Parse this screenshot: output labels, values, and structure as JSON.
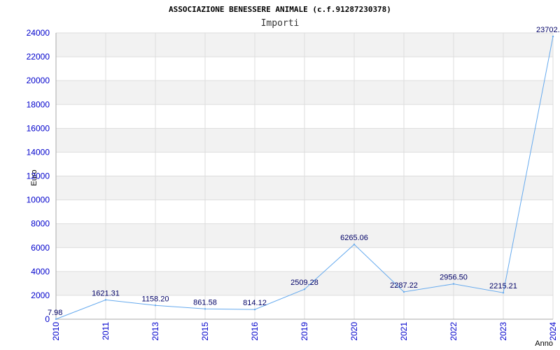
{
  "chart_data": {
    "type": "line",
    "title": "ASSOCIAZIONE BENESSERE ANIMALE (c.f.91287230378)",
    "subtitle": "Importi",
    "xlabel": "Anno",
    "ylabel": "Euro",
    "ylim": [
      0,
      24000
    ],
    "yticks": [
      "0",
      "2000",
      "4000",
      "6000",
      "8000",
      "10000",
      "12000",
      "14000",
      "16000",
      "18000",
      "20000",
      "22000",
      "24000"
    ],
    "grid": true,
    "categories": [
      "2010",
      "2011",
      "2013",
      "2015",
      "2016",
      "2019",
      "2020",
      "2021",
      "2022",
      "2023",
      "2024"
    ],
    "values": [
      7.98,
      1621.31,
      1158.2,
      861.58,
      814.12,
      2509.28,
      6265.06,
      2287.22,
      2956.5,
      2215.21,
      23702
    ],
    "data_labels": [
      "7.98",
      "1621.31",
      "1158.20",
      "861.58",
      "814.12",
      "2509.28",
      "6265.06",
      "2287.22",
      "2956.50",
      "2215.21",
      "23702."
    ],
    "colors": {
      "line": "#66aaee",
      "band": "#f2f2f2",
      "grid": "#dddddd",
      "axis": "#aaaaaa",
      "tick": "#0000cc",
      "label": "#000066"
    }
  }
}
